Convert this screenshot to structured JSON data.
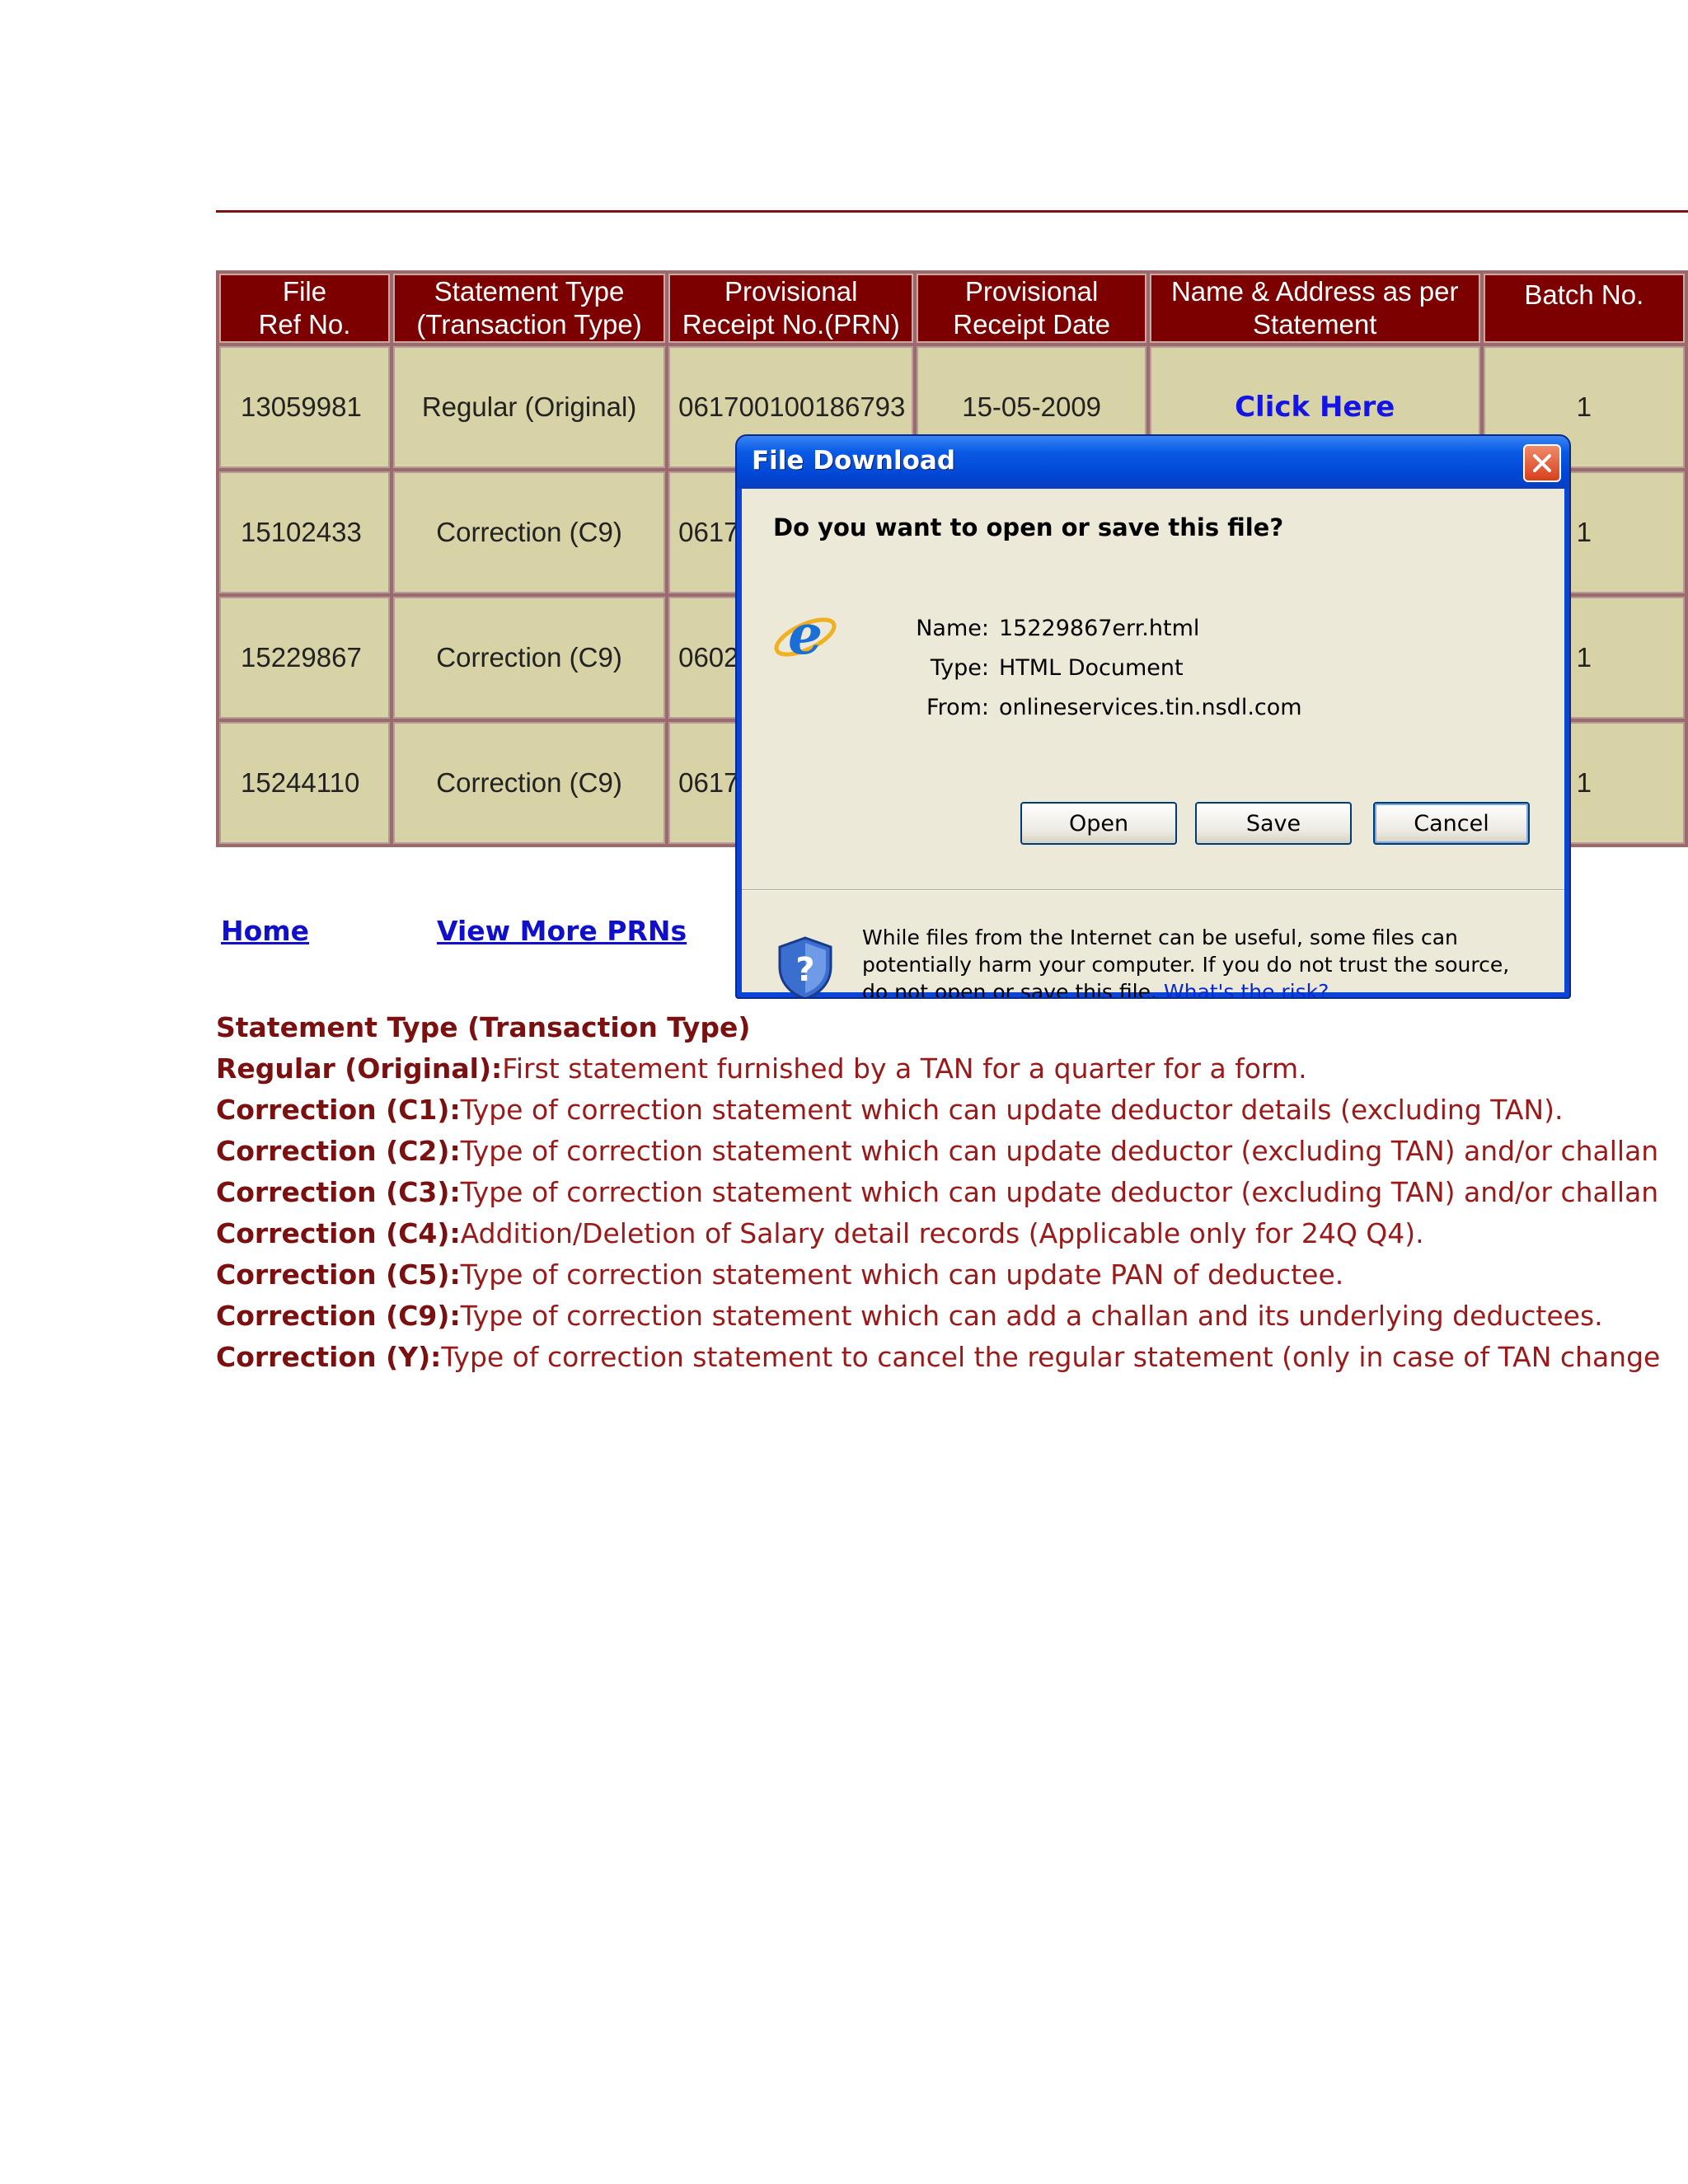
{
  "table": {
    "headers": [
      {
        "line1": "File",
        "line2": "Ref No."
      },
      {
        "line1": "Statement Type",
        "line2": "(Transaction Type)"
      },
      {
        "line1": "Provisional",
        "line2": "Receipt No.(PRN)"
      },
      {
        "line1": "Provisional",
        "line2": "Receipt Date"
      },
      {
        "line1": "Name & Address as per",
        "line2": "Statement"
      },
      {
        "line1": "Batch No.",
        "line2": ""
      }
    ],
    "rows": [
      {
        "ref": "13059981",
        "type": "Regular (Original)",
        "prn": "061700100186793",
        "date": "15-05-2009",
        "link": "Click Here",
        "batch": "1"
      },
      {
        "ref": "15102433",
        "type": "Correction (C9)",
        "prn": "0617",
        "date": "",
        "link": "",
        "batch": "1"
      },
      {
        "ref": "15229867",
        "type": "Correction (C9)",
        "prn": "0602",
        "date": "",
        "link": "",
        "batch": "1"
      },
      {
        "ref": "15244110",
        "type": "Correction (C9)",
        "prn": "0617",
        "date": "",
        "link": "",
        "batch": "1"
      }
    ]
  },
  "nav": {
    "home": "Home",
    "view_more": "View More PRNs"
  },
  "legend": {
    "heading": "Statement Type (Transaction Type)",
    "items": [
      {
        "term": "Regular (Original):",
        "desc": "First statement furnished by a TAN for a quarter for a form."
      },
      {
        "term": "Correction (C1):",
        "desc": "Type of correction statement which can update deductor details (excluding TAN)."
      },
      {
        "term": "Correction (C2):",
        "desc": "Type of correction statement which can update deductor (excluding TAN) and/or challan"
      },
      {
        "term": "Correction (C3):",
        "desc": "Type of correction statement which can update deductor (excluding TAN) and/or challan"
      },
      {
        "term": "Correction (C4):",
        "desc": "Addition/Deletion of Salary detail records (Applicable only for 24Q Q4)."
      },
      {
        "term": "Correction (C5):",
        "desc": "Type of correction statement which can update PAN of deductee."
      },
      {
        "term": "Correction (C9):",
        "desc": "Type of correction statement which can add a challan and its underlying deductees."
      },
      {
        "term": "Correction (Y):",
        "desc": "Type of correction statement to cancel the regular statement (only in case of TAN change"
      }
    ]
  },
  "dialog": {
    "title": "File Download",
    "question": "Do you want to open or save this file?",
    "name_label": "Name:",
    "name_value": "15229867err.html",
    "type_label": "Type:",
    "type_value": "HTML Document",
    "from_label": "From:",
    "from_value": "onlineservices.tin.nsdl.com",
    "open_label": "Open",
    "save_label": "Save",
    "cancel_label": "Cancel",
    "warning_text": "While files from the Internet can be useful, some files can potentially harm your computer. If you do not trust the source, do not open or save this file.",
    "risk_link": "What's the risk?"
  },
  "colors": {
    "header_bg": "#7d0000",
    "cell_bg": "#d7d3a6",
    "legend_text": "#9a1a1a",
    "link": "#1010cc",
    "dialog_frame": "#0b45d8",
    "dialog_body": "#ece9d8"
  },
  "icons": [
    "internet-explorer-icon",
    "security-shield-icon",
    "close-icon"
  ]
}
